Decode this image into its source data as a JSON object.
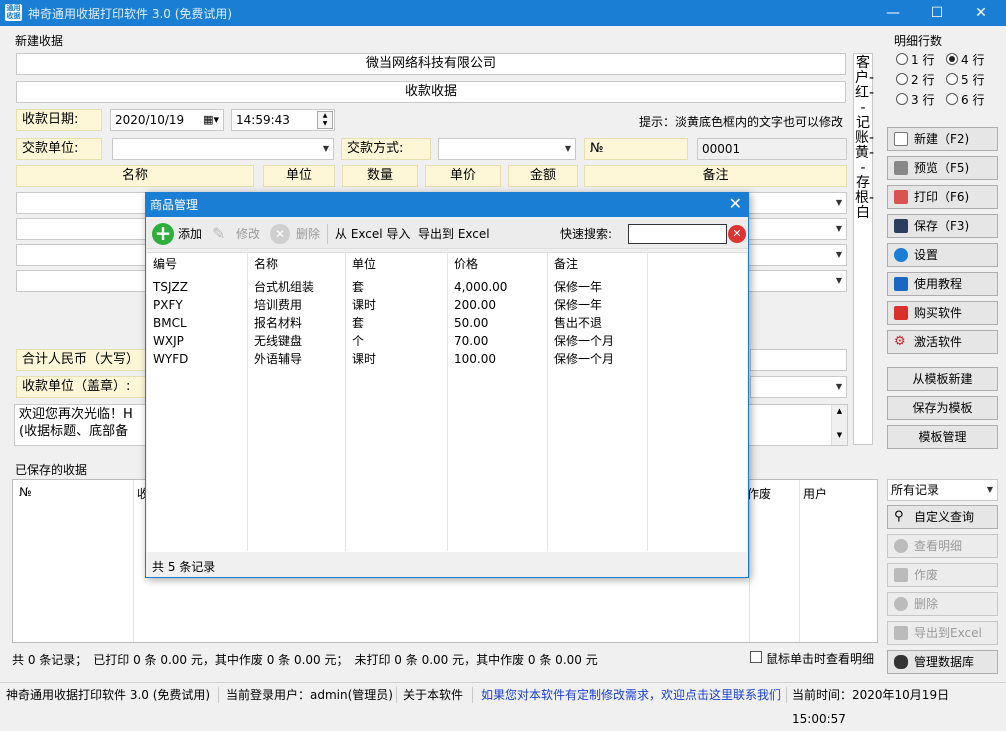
{
  "window": {
    "title": "神奇通用收据打印软件 3.0 (免费试用)",
    "icon_text": "通用收据"
  },
  "form": {
    "group_label": "新建收据",
    "company": "微当网络科技有限公司",
    "receipt_title": "收款收据",
    "date_label": "收款日期:",
    "date_value": "2020/10/19",
    "time_value": "14:59:43",
    "hint": "提示：淡黄底色框内的文字也可以修改",
    "payer_label": "交款单位:",
    "method_label": "交款方式:",
    "no_label": "№",
    "no_value": "00001",
    "columns": [
      "名称",
      "单位",
      "数量",
      "单价",
      "金额",
      "备注"
    ],
    "total_label": "合计人民币（大写）",
    "stamp_label": "收款单位（盖章）:",
    "message_line1": "欢迎您再次光临！H",
    "message_line2": "(收据标题、底部备",
    "side_text": "客户-红--记账-黄--存根-白"
  },
  "detail_rows": {
    "label": "明细行数",
    "options": [
      "1 行",
      "4 行",
      "2 行",
      "5 行",
      "3 行",
      "6 行"
    ],
    "selected": "4 行"
  },
  "buttons": {
    "new": "新建（F2)",
    "preview": "预览（F5)",
    "print": "打印（F6)",
    "save": "保存（F3)",
    "settings": "设置",
    "tutorial": "使用教程",
    "buy": "购买软件",
    "activate": "激活软件",
    "from_template": "从模板新建",
    "save_template": "保存为模板",
    "template_mgr": "模板管理",
    "custom_query": "自定义查询",
    "view_detail": "查看明细",
    "void": "作废",
    "delete": "删除",
    "export": "导出到Excel",
    "manage_db": "管理数据库"
  },
  "saved": {
    "label": "已保存的收据",
    "filter": "所有记录",
    "col_no": "№",
    "col_partial": "收",
    "col_void": "作废",
    "col_user": "用户",
    "summary": "共 0 条记录；　已打印 0 条 0.00 元，其中作废 0 条 0.00 元；　未打印 0 条 0.00 元，其中作废 0 条 0.00 元",
    "click_label": "鼠标单击时查看明细"
  },
  "dialog": {
    "title": "商品管理",
    "add": "添加",
    "edit": "修改",
    "remove": "删除",
    "import": "从 Excel 导入",
    "export": "导出到 Excel",
    "search_label": "快速搜索:",
    "headers": [
      "编号",
      "名称",
      "单位",
      "价格",
      "备注"
    ],
    "rows": [
      [
        "TSJZZ",
        "台式机组装",
        "套",
        "4,000.00",
        "保修一年"
      ],
      [
        "PXFY",
        "培训费用",
        "课时",
        "200.00",
        "保修一年"
      ],
      [
        "BMCL",
        "报名材料",
        "套",
        "50.00",
        "售出不退"
      ],
      [
        "WXJP",
        "无线键盘",
        "个",
        "70.00",
        "保修一个月"
      ],
      [
        "WYFD",
        "外语辅导",
        "课时",
        "100.00",
        "保修一个月"
      ]
    ],
    "footer": "共 5 条记录"
  },
  "statusbar": {
    "app": "神奇通用收据打印软件 3.0 (免费试用)",
    "user": "当前登录用户：admin(管理员)",
    "about": "关于本软件",
    "link": "如果您对本软件有定制修改需求，欢迎点击这里联系我们",
    "time": "当前时间：2020年10月19日 15:00:57"
  },
  "colors": {
    "accent": "#1a7fd4",
    "field_yellow": "#fdf7d7",
    "link": "#1a3fd0"
  }
}
